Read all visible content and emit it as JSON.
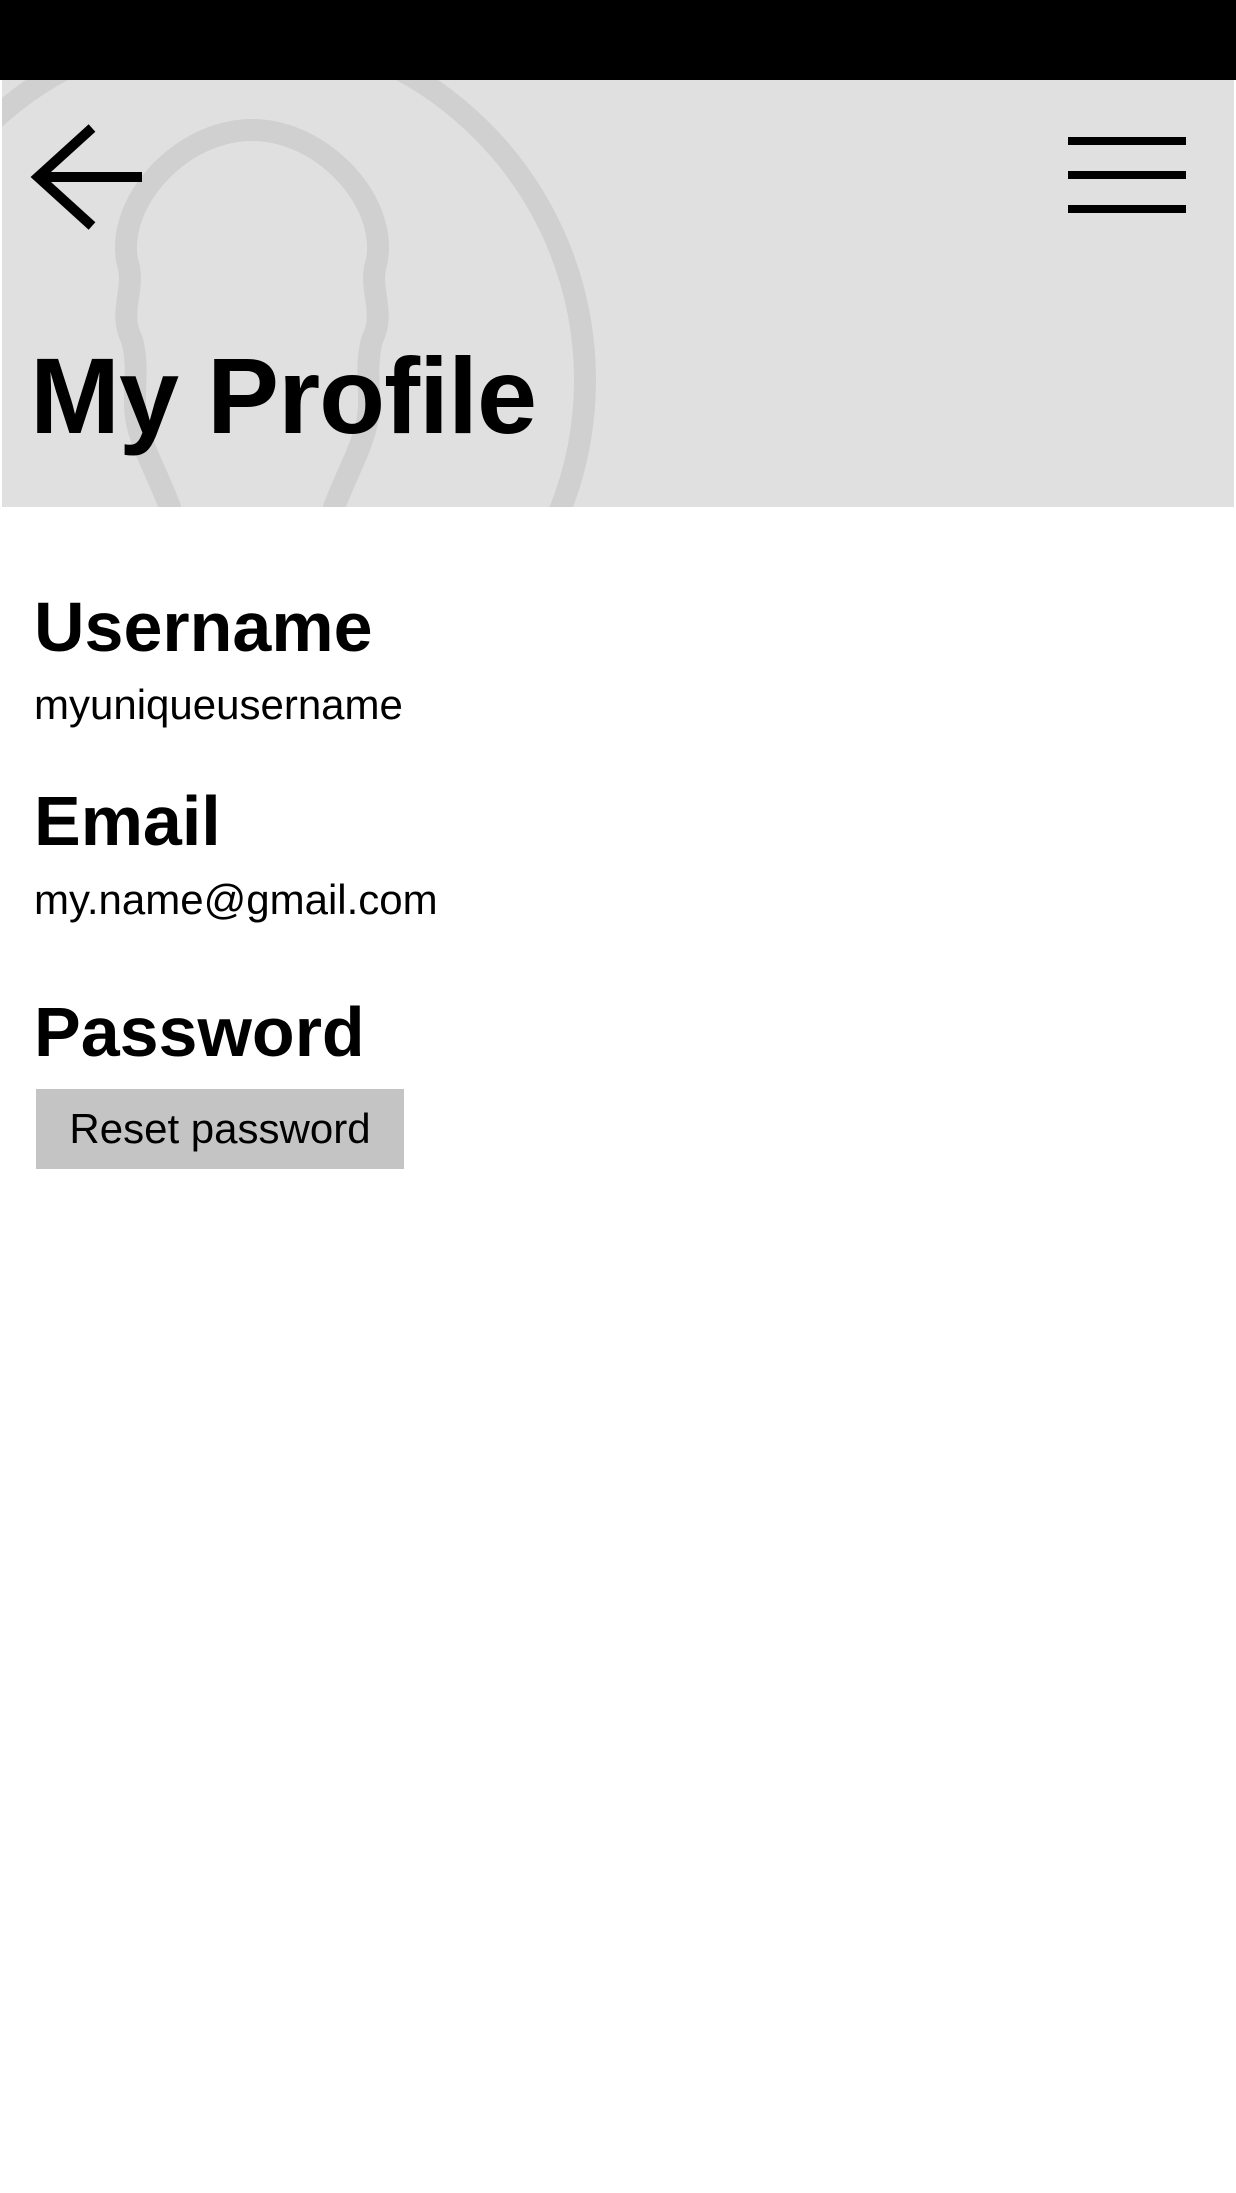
{
  "header": {
    "title": "My Profile",
    "back_icon": "arrow-left-icon",
    "menu_icon": "hamburger-menu-icon",
    "background_color": "#e0e0e0",
    "watermark_icon": "user-avatar-icon"
  },
  "profile": {
    "username_label": "Username",
    "username_value": "myuniqueusername",
    "email_label": "Email",
    "email_value": "my.name@gmail.com",
    "password_label": "Password",
    "reset_password_label": "Reset password"
  },
  "colors": {
    "status_bar": "#000000",
    "button_background": "#c4c4c4",
    "text": "#000000"
  }
}
